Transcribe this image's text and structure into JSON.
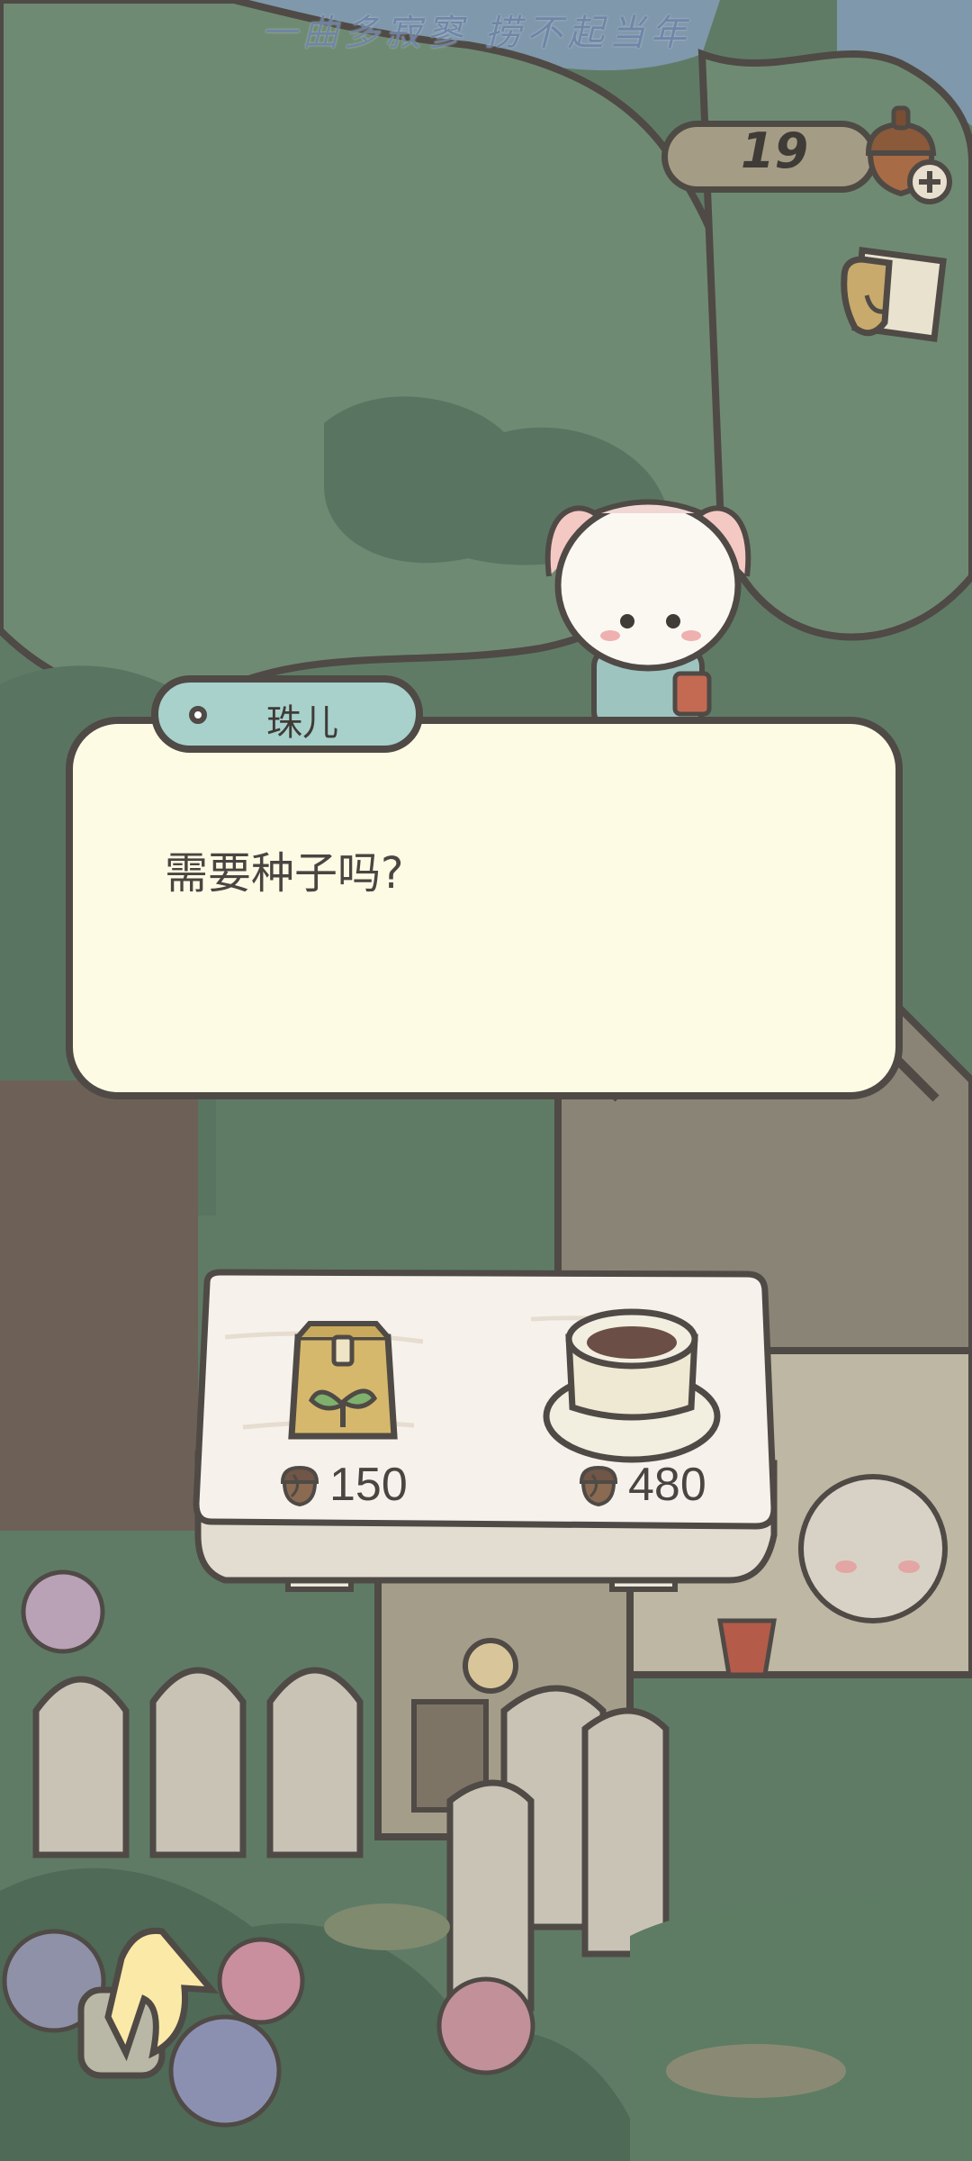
{
  "status_bar": {
    "lyrics": "一曲多寂寥 捞不起当年"
  },
  "hud": {
    "acorn_count": "19",
    "acorn_icon": "acorn-plus-icon",
    "note_icon": "paper-note-icon"
  },
  "dialog": {
    "speaker": "珠儿",
    "message": "需要种子吗?"
  },
  "shop": {
    "items": [
      {
        "name_icon": "seed-bag-icon",
        "price": "150",
        "currency_icon": "acorn-icon"
      },
      {
        "name_icon": "tea-cup-icon",
        "price": "480",
        "currency_icon": "acorn-icon"
      }
    ]
  },
  "navigation": {
    "back_icon": "back-arrow-icon"
  },
  "colors": {
    "dialog_bg": "#fefbe5",
    "nameplate_bg": "#a8d1cb",
    "outline": "#4f4a45",
    "forest": "#5f7b66"
  }
}
